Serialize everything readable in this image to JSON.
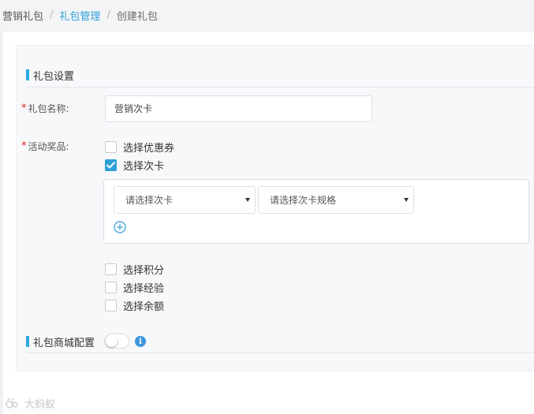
{
  "breadcrumb": {
    "items": [
      "营销礼包",
      "礼包管理",
      "创建礼包"
    ],
    "separator": "/"
  },
  "gift_settings": {
    "section_title": "礼包设置",
    "name_label": "礼包名称:",
    "name_value": "营销次卡",
    "prizes_label": "活动奖品:",
    "options": [
      {
        "label": "选择优惠券",
        "checked": false
      },
      {
        "label": "选择次卡",
        "checked": true
      },
      {
        "label": "选择积分",
        "checked": false
      },
      {
        "label": "选择经验",
        "checked": false
      },
      {
        "label": "选择余额",
        "checked": false
      }
    ],
    "card_select_placeholder": "请选择次卡",
    "spec_select_placeholder": "请选择次卡规格",
    "add_icon": "plus-circle-icon"
  },
  "mall_config": {
    "section_title": "礼包商城配置",
    "toggle_on": false,
    "info_icon": "info-icon",
    "info_symbol": "i"
  },
  "required_mark": "*",
  "watermark": "大蚂蚁",
  "colors": {
    "accent": "#2d9fd6",
    "section_bar": "#2aa8e0",
    "required": "#e02020",
    "info": "#3f95dd"
  }
}
